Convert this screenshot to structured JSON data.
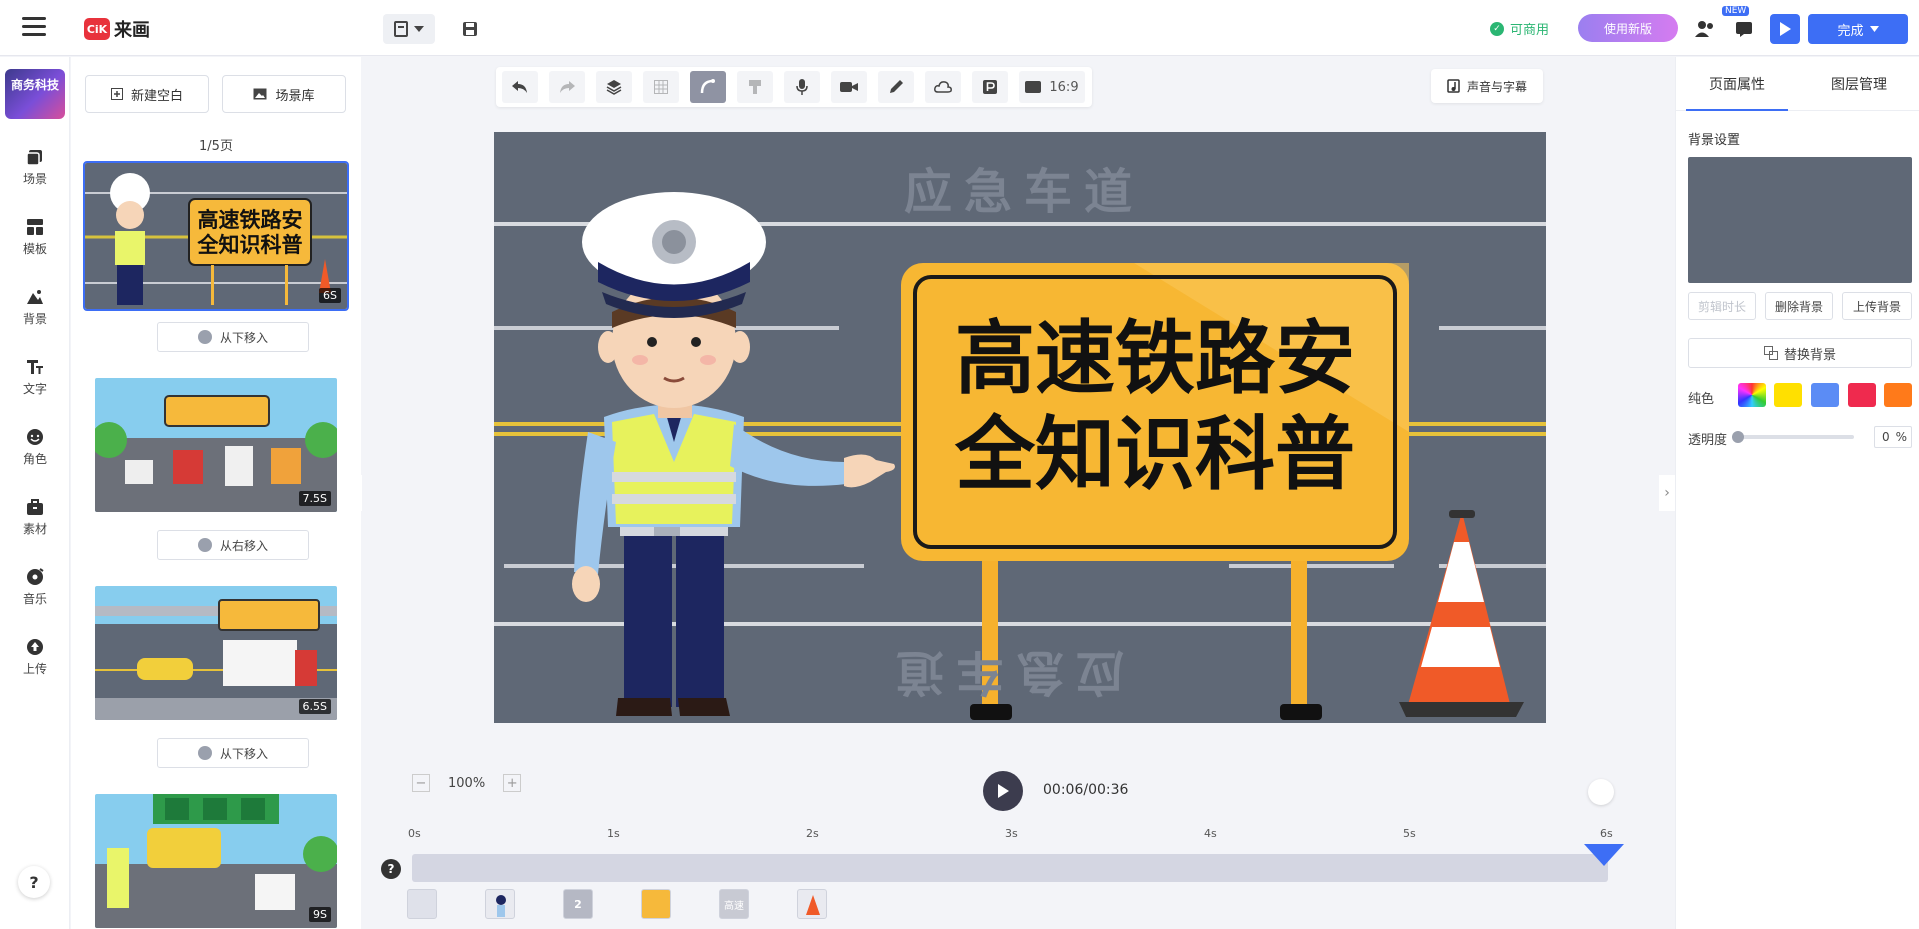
{
  "app": {
    "logo_badge": "CiK",
    "logo_text": "来画"
  },
  "header": {
    "status": "可商用",
    "new_version": "使用新版",
    "new_tag": "NEW",
    "done": "完成"
  },
  "leftnav": {
    "project_thumb": "商务科技",
    "items": [
      {
        "label": "场景",
        "icon": "scene-icon"
      },
      {
        "label": "模板",
        "icon": "template-icon"
      },
      {
        "label": "背景",
        "icon": "background-icon"
      },
      {
        "label": "文字",
        "icon": "text-icon"
      },
      {
        "label": "角色",
        "icon": "character-icon"
      },
      {
        "label": "素材",
        "icon": "material-icon"
      },
      {
        "label": "音乐",
        "icon": "music-icon"
      },
      {
        "label": "上传",
        "icon": "upload-icon"
      }
    ],
    "help": "?"
  },
  "scenes": {
    "new_blank": "新建空白",
    "scene_library": "场景库",
    "page_count": "1/5页",
    "list": [
      {
        "duration": "6S",
        "transition": "从下移入"
      },
      {
        "duration": "7.5S",
        "transition": "从右移入"
      },
      {
        "duration": "6.5S",
        "transition": "从下移入"
      },
      {
        "duration": "9S"
      }
    ]
  },
  "toolbar": {
    "ratio": "16:9",
    "sound_subtitle": "声音与字幕"
  },
  "stage": {
    "sign_line1": "高速铁路安",
    "sign_line2": "全知识科普",
    "road_text_top": "应急车道",
    "road_text_bottom": "应急车道"
  },
  "timeline": {
    "zoom": "100%",
    "timecode": "00:06/00:36",
    "ticks": [
      "0s",
      "1s",
      "2s",
      "3s",
      "4s",
      "5s",
      "6s"
    ],
    "help": "?",
    "layer_labels": [
      "2",
      "高速"
    ]
  },
  "props": {
    "tab_page": "页面属性",
    "tab_layers": "图层管理",
    "bg_settings": "背景设置",
    "bg_color": "#5f6876",
    "trim": "剪辑时长",
    "delete_bg": "删除背景",
    "upload_bg": "上传背景",
    "replace_bg": "替换背景",
    "solid": "纯色",
    "swatches": [
      "#ffe000",
      "#5b8cf5",
      "#ef2a4e",
      "#ff7a1a"
    ],
    "opacity_label": "透明度",
    "opacity_value": "0",
    "opacity_unit": "%"
  }
}
